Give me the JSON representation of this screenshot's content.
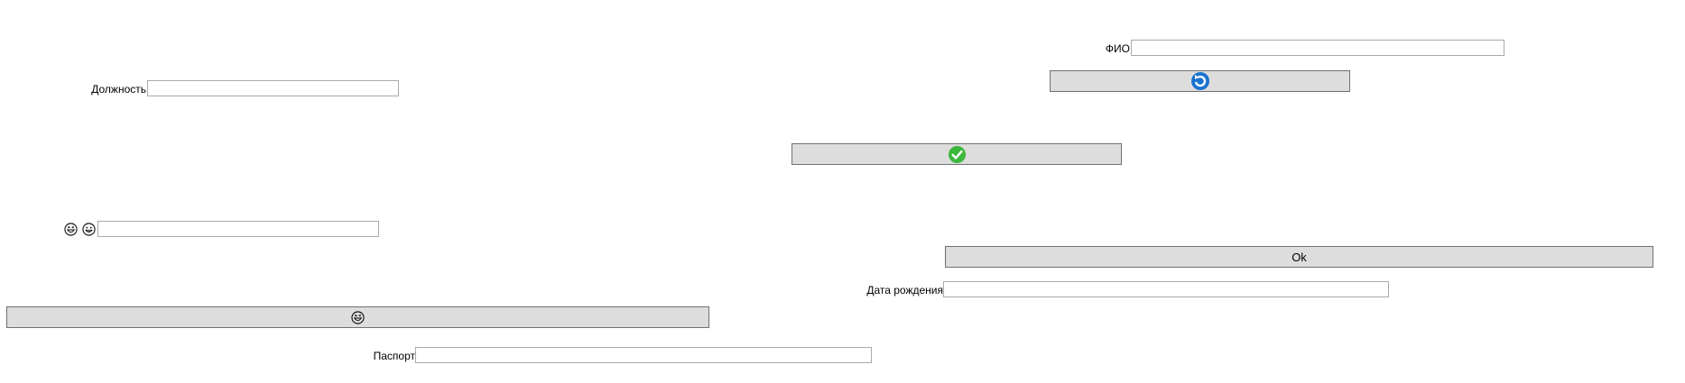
{
  "form": {
    "fio": {
      "label": "ФИО",
      "value": ""
    },
    "position": {
      "label": "Должность",
      "value": ""
    },
    "emoji_field": {
      "label_icons": [
        "laughing-face-icon",
        "grinning-face-icon"
      ],
      "value": ""
    },
    "birth_date": {
      "label": "Дата рождения",
      "value": ""
    },
    "passport": {
      "label": "Паспорт",
      "value": ""
    }
  },
  "buttons": {
    "refresh": {
      "icon": "refresh-icon",
      "label": ""
    },
    "confirm": {
      "icon": "check-icon",
      "label": ""
    },
    "ok": {
      "label": "Ok"
    },
    "emoji": {
      "icon": "laughing-face-icon",
      "label": ""
    }
  },
  "colors": {
    "button_bg": "#dddddd",
    "button_border": "#707070",
    "field_border": "#a9a9a9",
    "refresh_icon": "#1a73d1",
    "check_icon": "#3db83d"
  }
}
